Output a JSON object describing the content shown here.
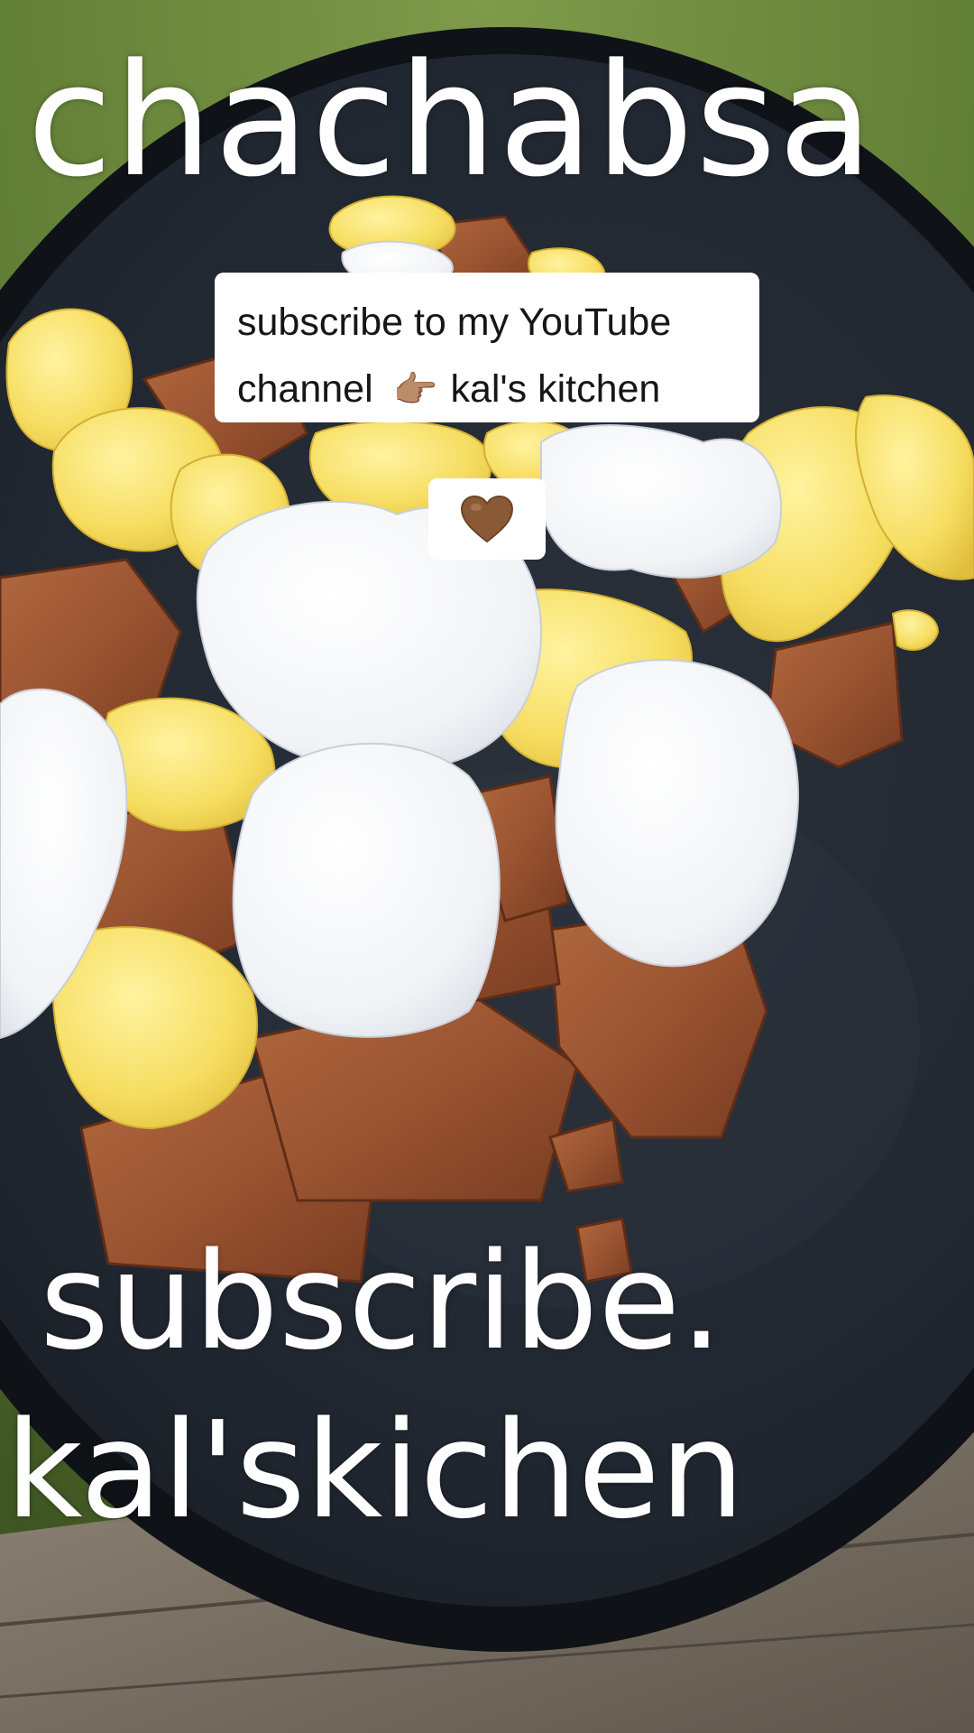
{
  "overlay": {
    "title": "chachabsa",
    "footer_line1": "subscribe.",
    "footer_line2": "kal'skichen"
  },
  "caption": {
    "line1": "subscribe to my YouTube",
    "line2_prefix": "channel",
    "pointer_icon": "pointing-right-hand-emoji",
    "pointer_glyph": "👉🏽",
    "line2_suffix": "kal's kitchen",
    "heart_icon": "brown-heart-emoji"
  },
  "colors": {
    "overlay_text": "#ffffff",
    "caption_bg": "#ffffff",
    "caption_text": "#161616",
    "heart": "#8a5a36"
  }
}
